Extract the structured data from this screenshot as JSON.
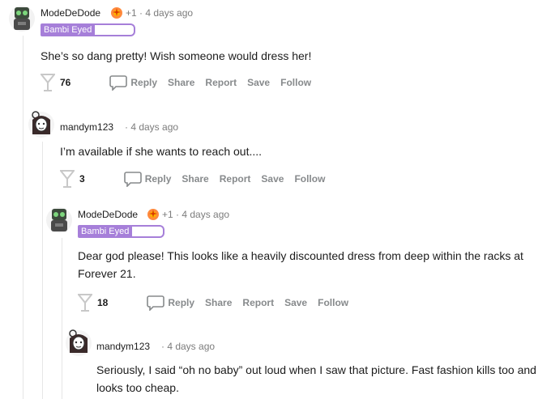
{
  "comments": [
    {
      "username": "ModeDeDode",
      "meta": "+1 · 4 days ago",
      "flair": "Bambi Eyed",
      "body": "She’s so dang pretty! Wish someone would dress her!",
      "votes": "76"
    },
    {
      "username": "mandym123",
      "meta": "· 4 days ago",
      "body": "I’m available if she wants to reach out....",
      "votes": "3"
    },
    {
      "username": "ModeDeDode",
      "meta": "+1 · 4 days ago",
      "flair": "Bambi Eyed",
      "body": "Dear god please! This looks like a heavily discounted dress from deep within the racks at Forever 21.",
      "votes": "18"
    },
    {
      "username": "mandym123",
      "meta": "· 4 days ago",
      "body": "Seriously, I said “oh no baby” out loud when I saw that picture. Fast fashion kills too and looks too cheap."
    }
  ],
  "actions": {
    "reply": "Reply",
    "share": "Share",
    "report": "Report",
    "save": "Save",
    "follow": "Follow"
  },
  "colors": {
    "flair_bg": "#a67fd9",
    "action_gray": "#878a8c",
    "text": "#1c1c1c",
    "meta_gray": "#7c7c7c"
  },
  "icons": [
    "robot-avatar-icon",
    "doodle-avatar-icon",
    "award-icon",
    "martini-vote-icon",
    "reply-bubble-icon"
  ]
}
